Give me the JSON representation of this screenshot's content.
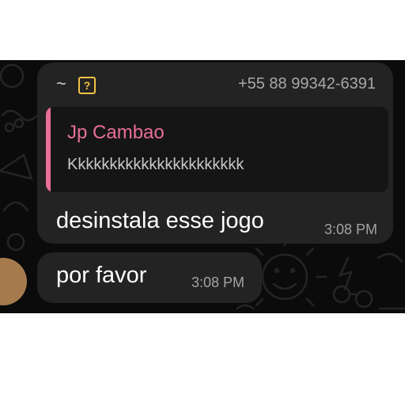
{
  "incoming_message": {
    "sender_prefix": "~",
    "sender_icon": "unknown-contact-icon",
    "sender_phone": "+55 88 99342-6391",
    "quoted_reply": {
      "author": "Jp Cambao",
      "text": "Kkkkkkkkkkkkkkkkkkkkkk"
    },
    "text": "desinstala esse jogo",
    "time": "3:08 PM"
  },
  "second_message": {
    "text": "por favor",
    "time": "3:08 PM"
  },
  "colors": {
    "chat_background": "#0b0b0b",
    "bubble": "#232323",
    "quote_accent": "#e86f9b",
    "unknown_icon": "#f2c244",
    "avatar": "#a57b4e"
  }
}
